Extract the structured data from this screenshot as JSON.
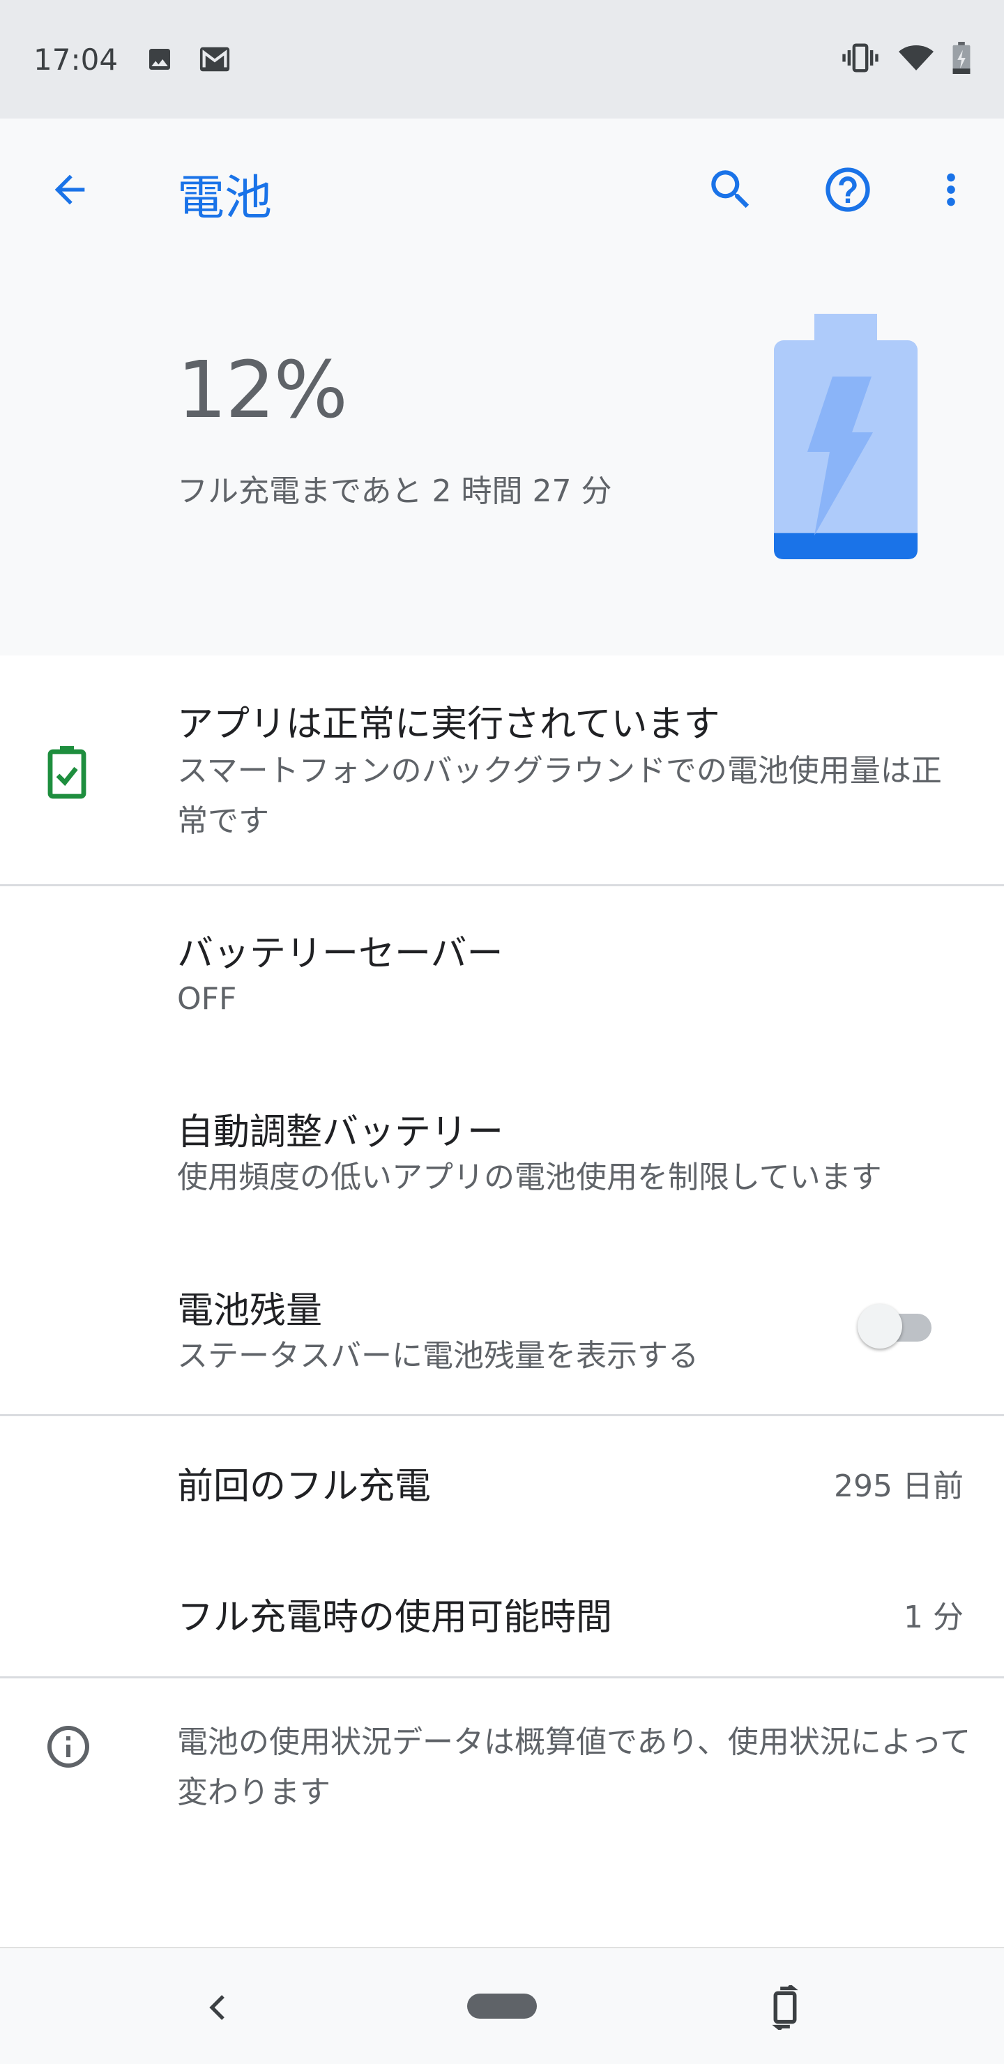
{
  "status_bar": {
    "time": "17:04",
    "icons": [
      "image-icon",
      "gmail-icon",
      "vibrate-icon",
      "wifi-icon",
      "battery-charging-icon"
    ]
  },
  "app_bar": {
    "title": "電池",
    "accent_color": "#1a73e8",
    "icons": [
      "back-arrow-icon",
      "search-icon",
      "help-icon",
      "more-vert-icon"
    ]
  },
  "battery": {
    "percent_text": "12%",
    "level": 0.12,
    "remaining": "フル充電まであと 2 時間 27 分"
  },
  "status_item": {
    "title": "アプリは正常に実行されています",
    "subtitle": "スマートフォンのバックグラウンドでの電池使用量は正常です",
    "icon": "battery-check-icon",
    "icon_color": "#1e8e3e"
  },
  "settings": [
    {
      "title": "バッテリーセーバー",
      "subtitle": "OFF"
    },
    {
      "title": "自動調整バッテリー",
      "subtitle": "使用頻度の低いアプリの電池使用を制限しています"
    },
    {
      "title": "電池残量",
      "subtitle": "ステータスバーに電池残量を表示する",
      "toggle_on": false
    }
  ],
  "stats": [
    {
      "label": "前回のフル充電",
      "value": "295 日前"
    },
    {
      "label": "フル充電時の使用可能時間",
      "value": "1 分"
    }
  ],
  "info": {
    "text": "電池の使用状況データは概算値であり、使用状況によって変わります",
    "icon": "info-icon"
  },
  "nav_bar": {
    "icons": [
      "nav-back-icon",
      "home-pill",
      "rotate-icon"
    ]
  }
}
